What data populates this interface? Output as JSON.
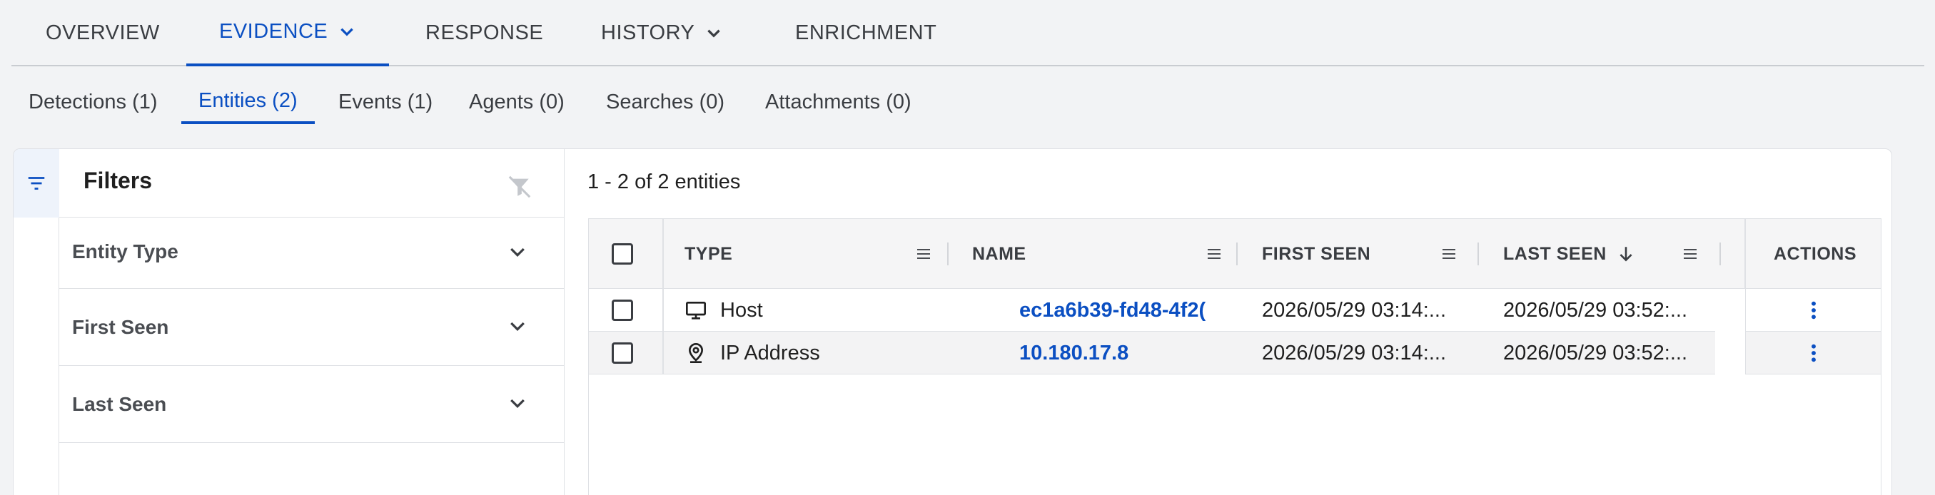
{
  "top_tabs": [
    {
      "label": "OVERVIEW"
    },
    {
      "label": "EVIDENCE"
    },
    {
      "label": "RESPONSE"
    },
    {
      "label": "HISTORY"
    },
    {
      "label": "ENRICHMENT"
    }
  ],
  "sub_tabs": [
    {
      "label": "Detections (1)"
    },
    {
      "label": "Entities (2)"
    },
    {
      "label": "Events (1)"
    },
    {
      "label": "Agents (0)"
    },
    {
      "label": "Searches (0)"
    },
    {
      "label": "Attachments (0)"
    }
  ],
  "filters": {
    "title": "Filters",
    "items": [
      {
        "label": "Entity Type"
      },
      {
        "label": "First Seen"
      },
      {
        "label": "Last Seen"
      }
    ]
  },
  "results": {
    "count_text": "1 - 2 of 2 entities"
  },
  "table": {
    "columns": [
      "TYPE",
      "NAME",
      "FIRST SEEN",
      "LAST SEEN",
      "ACTIONS"
    ],
    "rows": [
      {
        "icon": "monitor-icon",
        "type": "Host",
        "name": "ec1a6b39-fd48-4f2(",
        "first_seen": "2026/05/29 03:14:...",
        "last_seen": "2026/05/29 03:52:..."
      },
      {
        "icon": "location-pin-icon",
        "type": "IP Address",
        "name": "10.180.17.8",
        "first_seen": "2026/05/29 03:14:...",
        "last_seen": "2026/05/29 03:52:..."
      }
    ]
  },
  "colors": {
    "accent": "#0b4fc2",
    "text": "#1f1f1f",
    "muted": "#3a3d42",
    "border": "#dfe1e5",
    "background": "#f2f3f5"
  }
}
